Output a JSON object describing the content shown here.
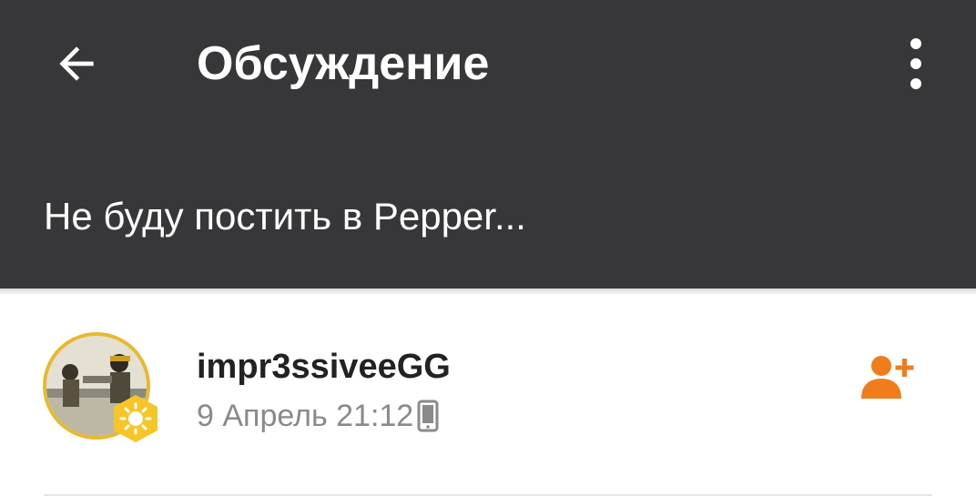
{
  "header": {
    "title": "Обсуждение",
    "subtitle": "Не буду постить в Pepper...",
    "background": "#37373a",
    "back_icon": "arrow-left-icon",
    "more_icon": "more-vertical-icon"
  },
  "post": {
    "author": "impr3ssiveeGG",
    "timestamp": "9 Апрель 21:12",
    "device_icon": "mobile-phone-icon",
    "badge_icon": "sun-hexagon-icon",
    "add_friend_icon": "add-friend-icon",
    "accent_color": "#f07c1c",
    "avatar_ring_color": "#e8b830"
  }
}
